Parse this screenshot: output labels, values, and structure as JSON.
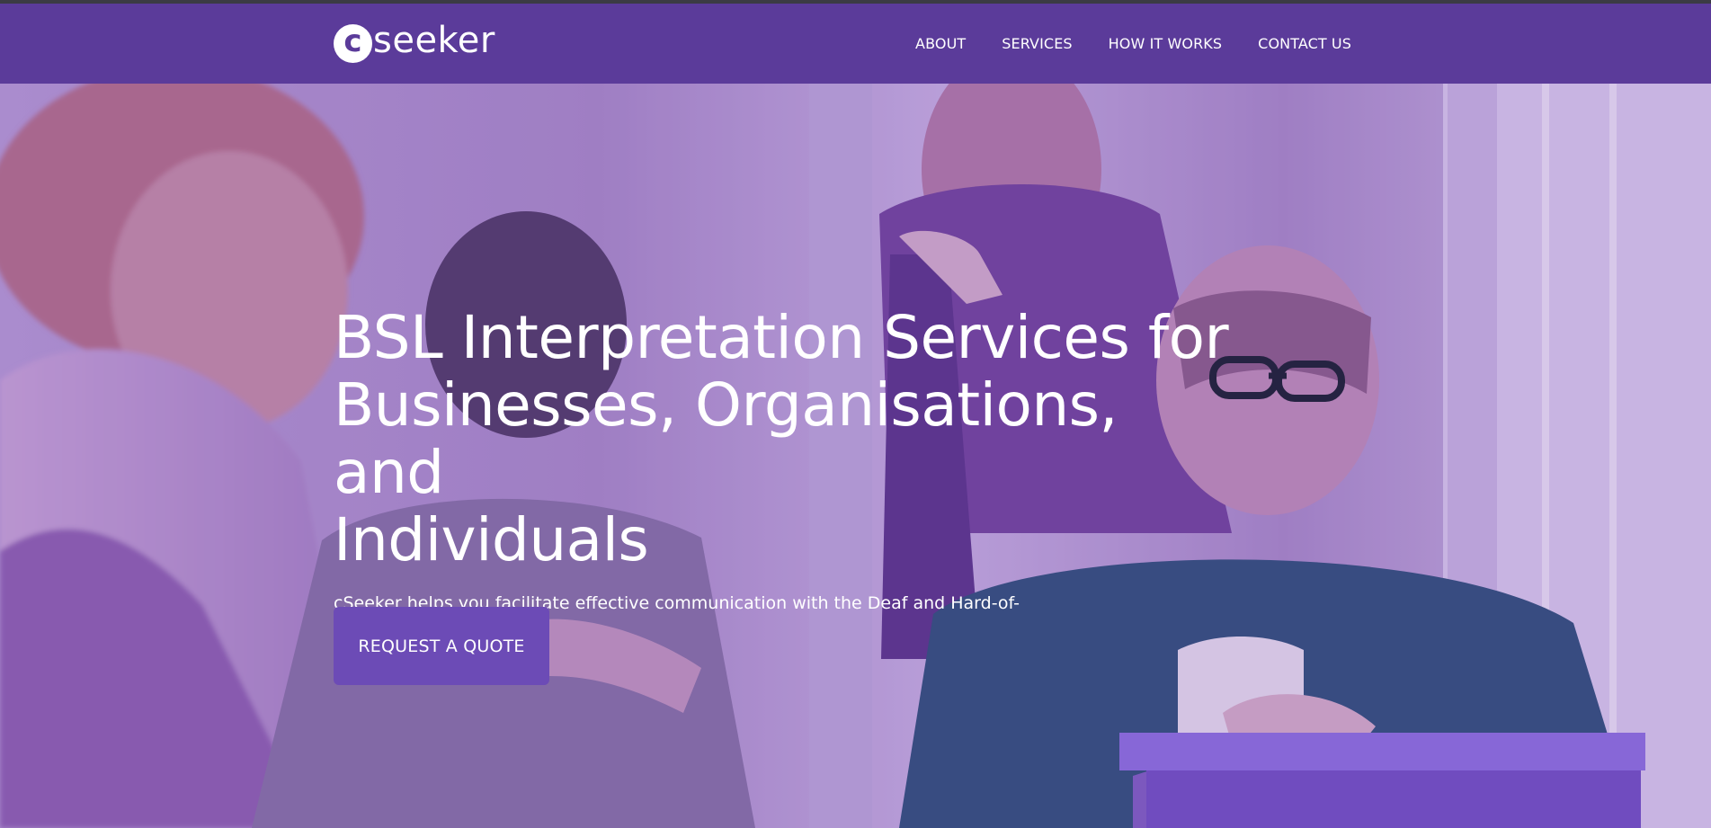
{
  "brand": {
    "logo_mark": "c",
    "logo_text": "seeker",
    "brand_color": "#5b3b9a"
  },
  "nav": {
    "items": [
      {
        "label": "ABOUT"
      },
      {
        "label": "SERVICES"
      },
      {
        "label": "HOW IT WORKS"
      },
      {
        "label": "CONTACT US"
      }
    ]
  },
  "hero": {
    "title_lines": [
      "BSL Interpretation Services for",
      "Businesses, Organisations, and",
      "Individuals"
    ],
    "subtitle": "cSeeker helps you facilitate effective communication with the Deaf and Hard-of-Hearing Community.",
    "cta_label": "REQUEST A QUOTE",
    "cta_color": "#6c4bb6"
  }
}
